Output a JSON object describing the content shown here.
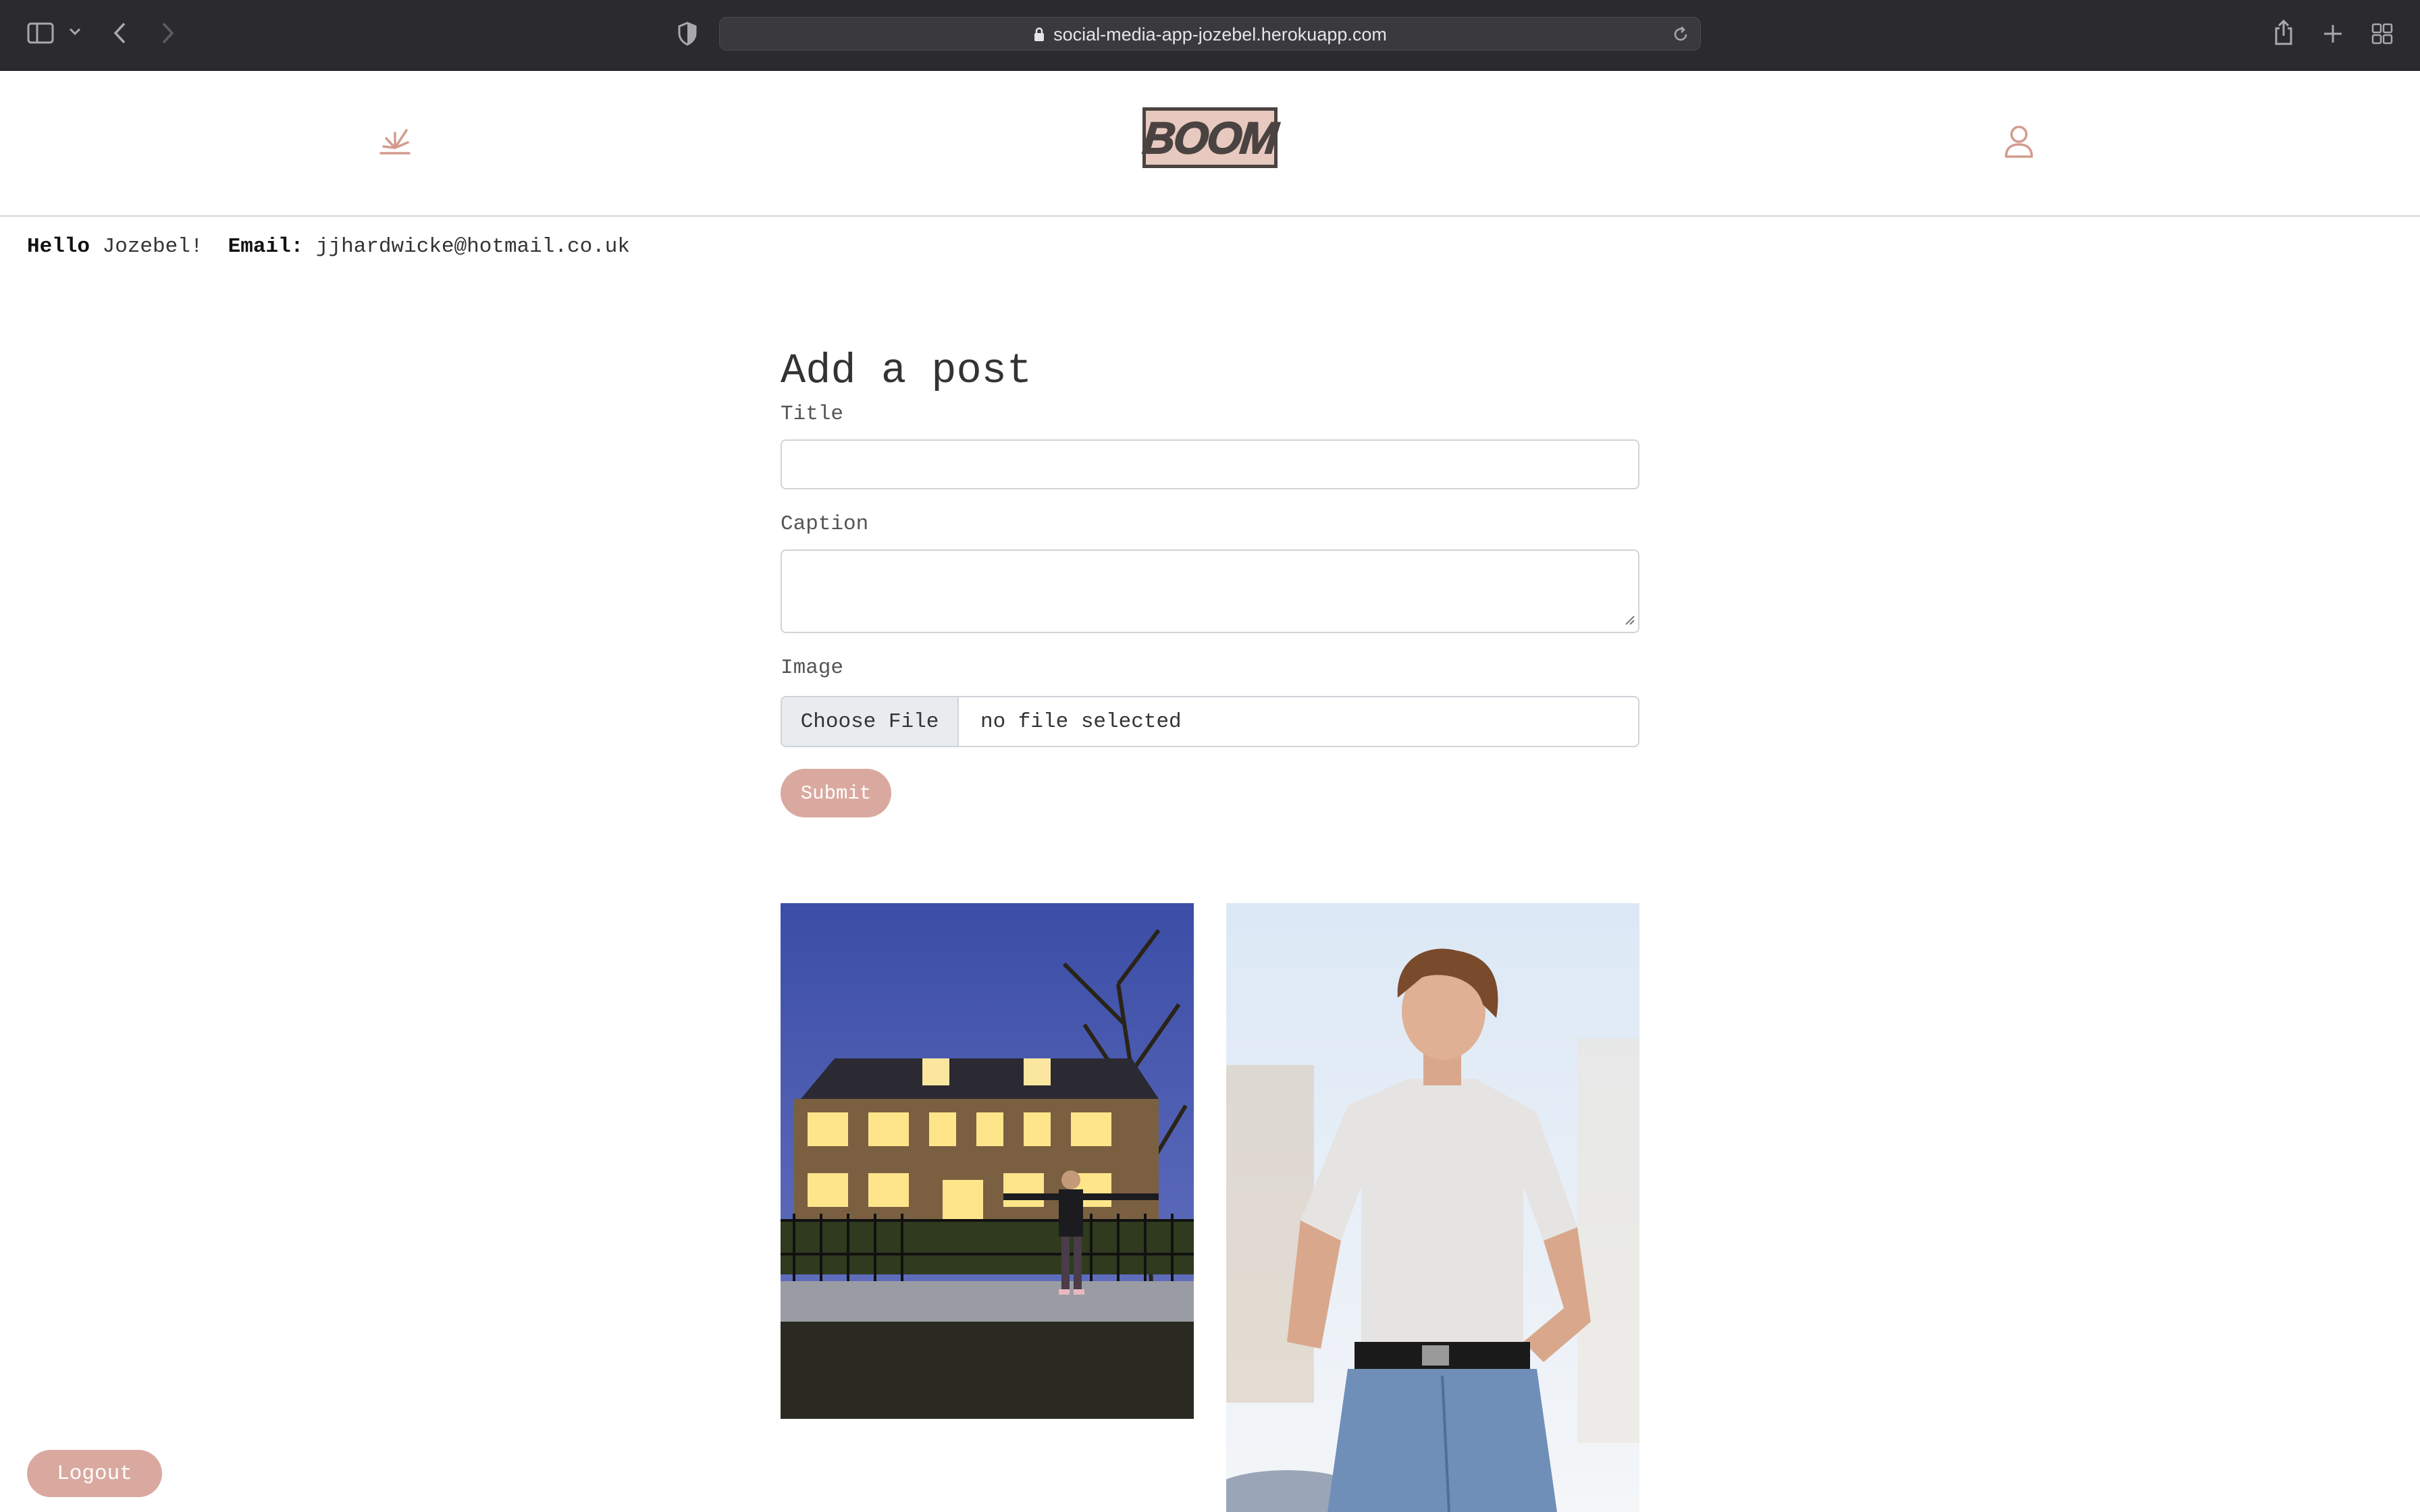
{
  "browser": {
    "url": "social-media-app-jozebel.herokuapp.com"
  },
  "nav": {
    "logo_text": "BOOM"
  },
  "greeting": {
    "hello_label": "Hello",
    "name": "Jozebel!",
    "email_label": "Email:",
    "email": "jjhardwicke@hotmail.co.uk"
  },
  "form": {
    "heading": "Add a post",
    "title_label": "Title",
    "title_value": "",
    "caption_label": "Caption",
    "caption_value": "",
    "image_label": "Image",
    "choose_file": "Choose File",
    "file_status": "no file selected",
    "submit": "Submit"
  },
  "posts": [
    {
      "image": "house-with-christmas-lights"
    },
    {
      "image": "man-in-white-tshirt"
    }
  ],
  "footer": {
    "logout": "Logout"
  },
  "colors": {
    "accent": "#d9a99f",
    "chrome": "#2b2b2d",
    "logo_bg": "#e7c9bf",
    "logo_fg": "#4a4341"
  }
}
